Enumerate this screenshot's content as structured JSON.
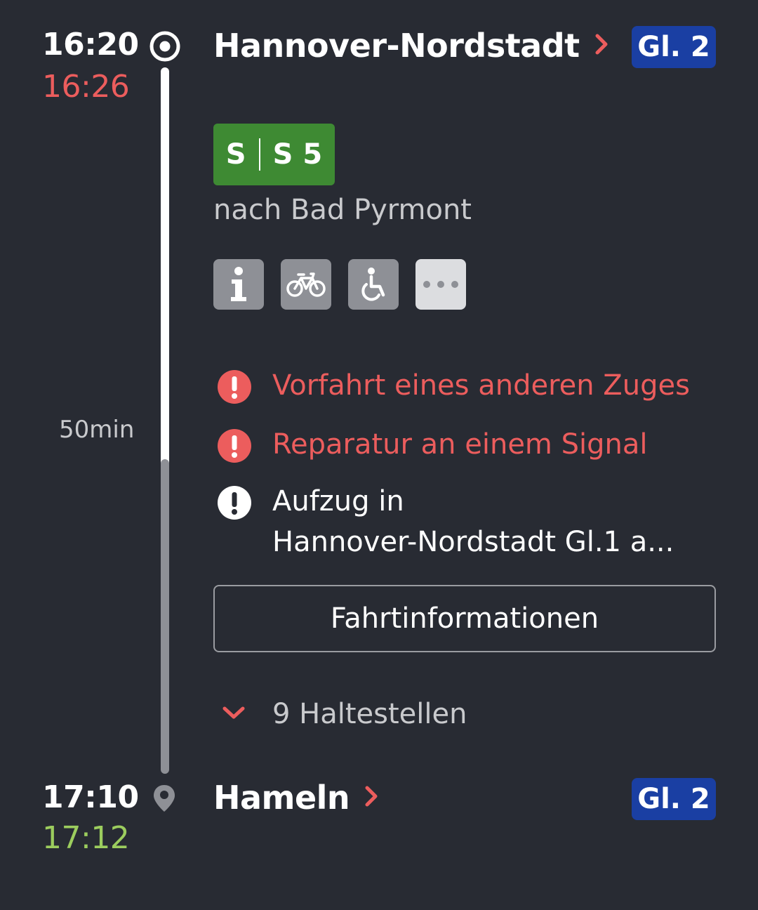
{
  "departure": {
    "scheduled_time": "16:20",
    "actual_time": "16:26",
    "station": "Hannover-Nordstadt",
    "platform": "Gl. 2"
  },
  "train": {
    "product": "S",
    "line": "S 5",
    "direction": "nach Bad Pyrmont",
    "line_color": "#3e8a33",
    "amenities": [
      "info-icon",
      "bicycle-icon",
      "wheelchair-icon",
      "more-icon"
    ]
  },
  "messages": [
    {
      "text": "Vorfahrt eines anderen Zuges",
      "severity": "warning"
    },
    {
      "text": "Reparatur an einem Signal",
      "severity": "warning"
    },
    {
      "line1": "Aufzug in",
      "line2": "Hannover-Nordstadt Gl.1 a...",
      "severity": "info"
    }
  ],
  "duration": "50min",
  "trip_info_button": "Fahrtinformationen",
  "stops_toggle": "9 Haltestellen",
  "arrival": {
    "scheduled_time": "17:10",
    "actual_time": "17:12",
    "station": "Hameln",
    "platform": "Gl. 2"
  },
  "colors": {
    "background": "#282b33",
    "delay_red": "#ec5d5d",
    "on_time_green": "#9ccd5e",
    "platform_blue": "#1a3fa3"
  }
}
